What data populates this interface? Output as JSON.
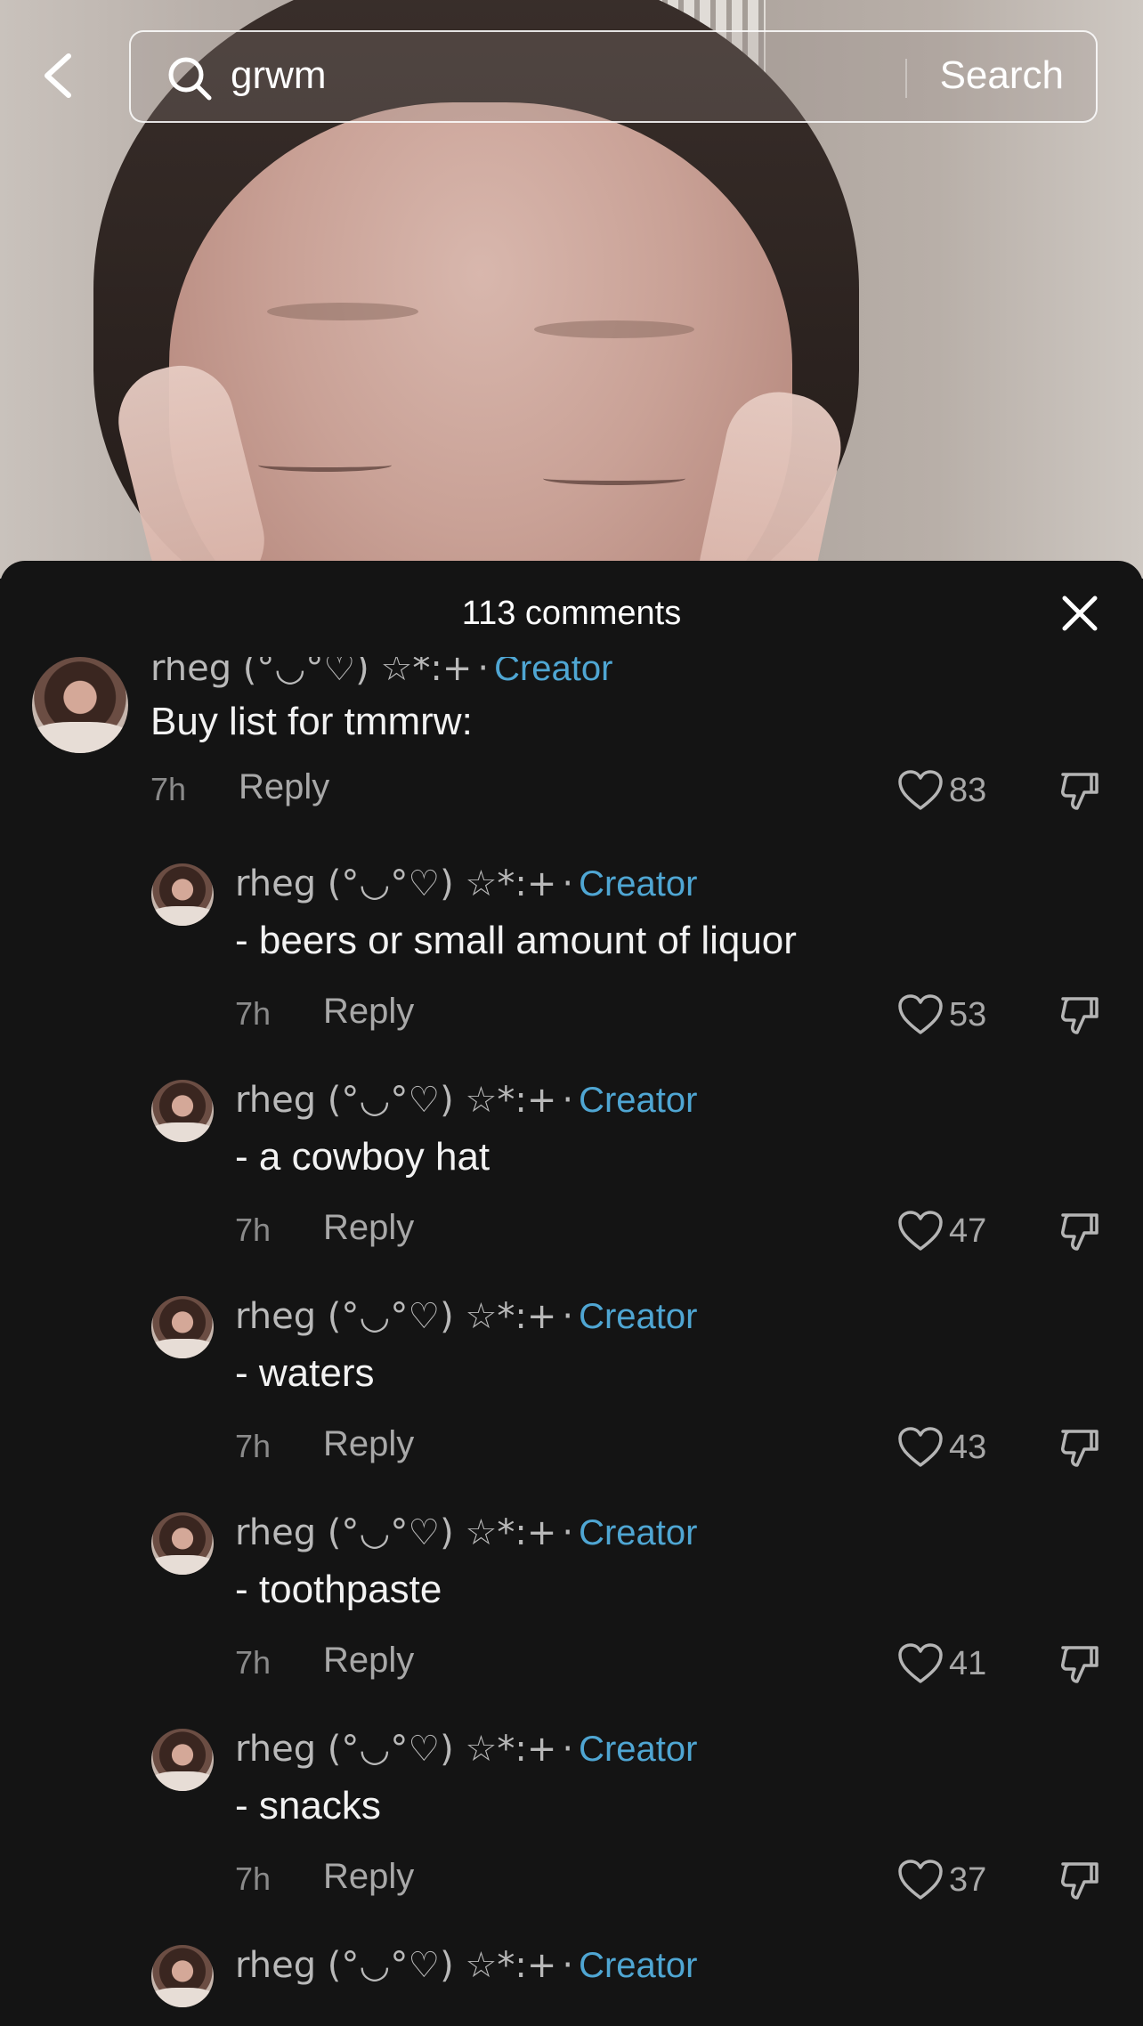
{
  "search": {
    "query": "grwm",
    "button_label": "Search"
  },
  "comments_sheet": {
    "title": "113 comments",
    "close_icon": "close-icon"
  },
  "comments": [
    {
      "author": "rheg (°◡°♡) ☆*:+",
      "separator": "·",
      "badge": "Creator",
      "text": "Buy list for tmmrw:",
      "time": "7h",
      "reply_label": "Reply",
      "likes": "83",
      "level": 0
    },
    {
      "author": "rheg (°◡°♡) ☆*:+",
      "separator": "·",
      "badge": "Creator",
      "text": "- beers or small amount of liquor",
      "time": "7h",
      "reply_label": "Reply",
      "likes": "53",
      "level": 1
    },
    {
      "author": "rheg (°◡°♡) ☆*:+",
      "separator": "·",
      "badge": "Creator",
      "text": "- a cowboy hat",
      "time": "7h",
      "reply_label": "Reply",
      "likes": "47",
      "level": 1
    },
    {
      "author": "rheg (°◡°♡) ☆*:+",
      "separator": "·",
      "badge": "Creator",
      "text": "- waters",
      "time": "7h",
      "reply_label": "Reply",
      "likes": "43",
      "level": 1
    },
    {
      "author": "rheg (°◡°♡) ☆*:+",
      "separator": "·",
      "badge": "Creator",
      "text": "- toothpaste",
      "time": "7h",
      "reply_label": "Reply",
      "likes": "41",
      "level": 1
    },
    {
      "author": "rheg (°◡°♡) ☆*:+",
      "separator": "·",
      "badge": "Creator",
      "text": "- snacks",
      "time": "7h",
      "reply_label": "Reply",
      "likes": "37",
      "level": 1
    },
    {
      "author": "rheg (°◡°♡) ☆*:+",
      "separator": "·",
      "badge": "Creator",
      "level": 1
    }
  ],
  "colors": {
    "sheet_background": "#141414",
    "creator_badge": "#4fa6d3",
    "secondary_text": "#a8a8a8"
  }
}
